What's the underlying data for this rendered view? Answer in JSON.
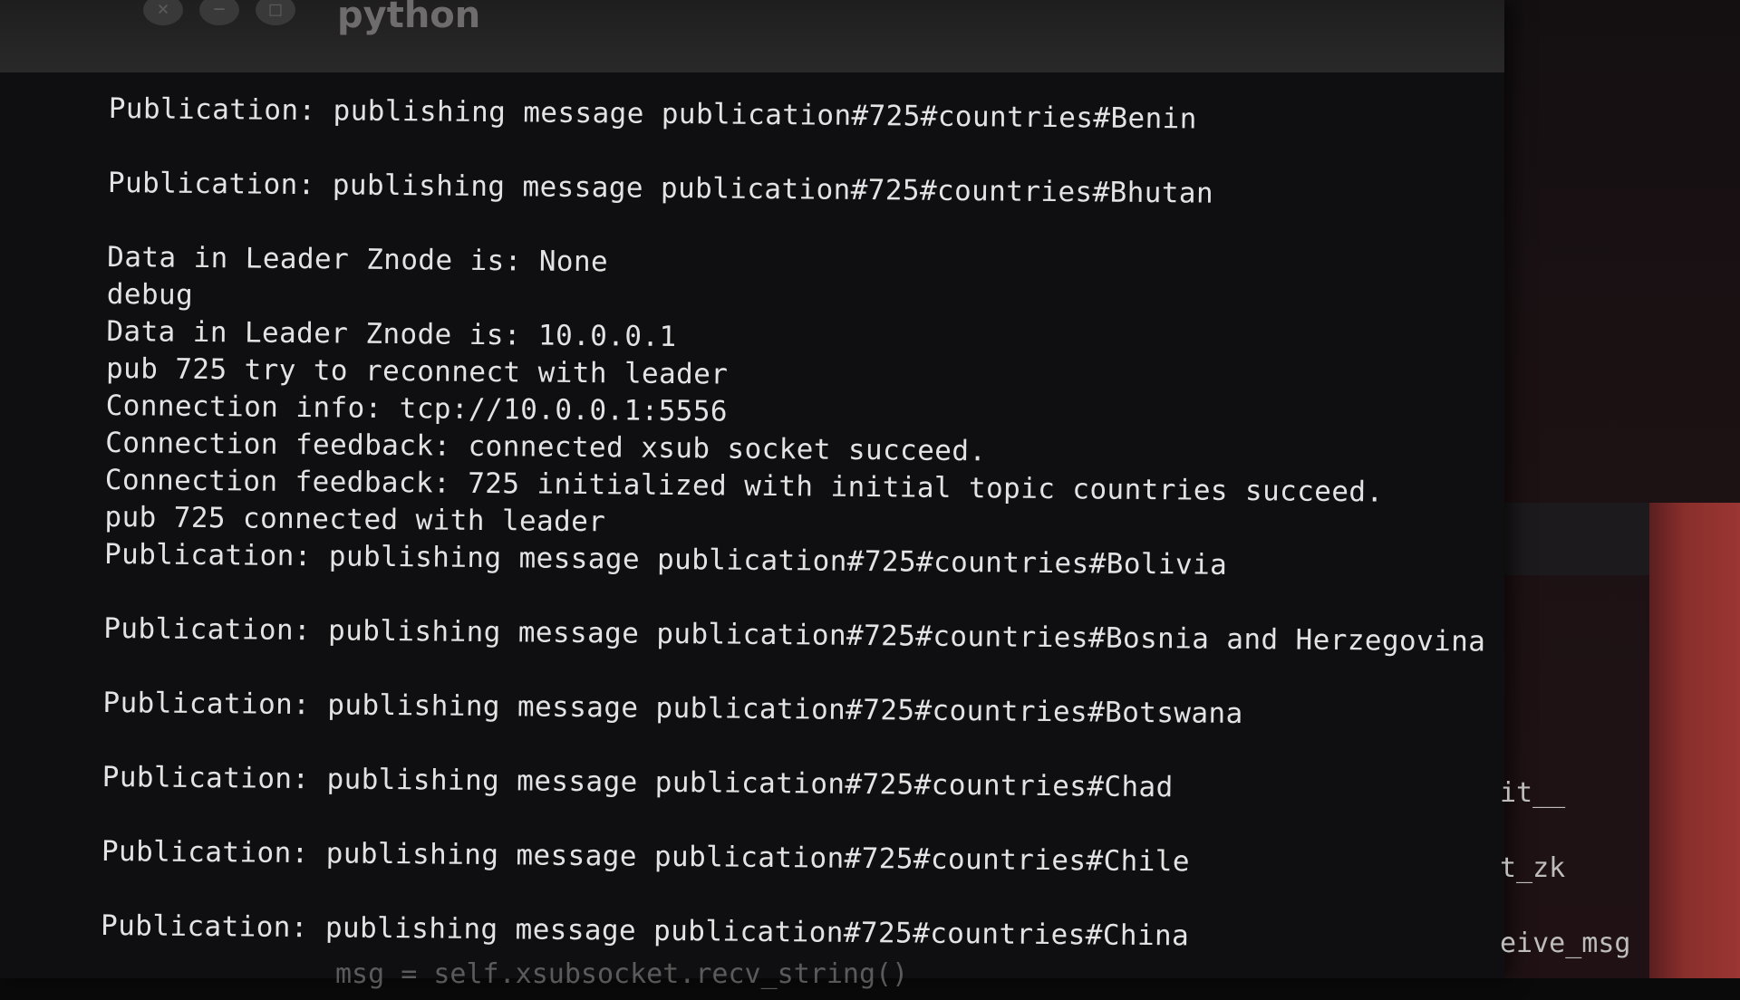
{
  "window": {
    "title": "python",
    "buttons": [
      "×",
      "−",
      "□"
    ]
  },
  "terminal": {
    "lines": [
      "Publication: publishing message publication#725#countries#Benin",
      "",
      "Publication: publishing message publication#725#countries#Bhutan",
      "",
      "Data in Leader Znode is: None",
      "debug",
      "Data in Leader Znode is: 10.0.0.1",
      "pub 725 try to reconnect with leader",
      "Connection info: tcp://10.0.0.1:5556",
      "Connection feedback: connected xsub socket succeed.",
      "Connection feedback: 725 initialized with initial topic countries succeed.",
      "pub 725 connected with leader",
      "Publication: publishing message publication#725#countries#Bolivia",
      "",
      "Publication: publishing message publication#725#countries#Bosnia and Herzegovina",
      "",
      "Publication: publishing message publication#725#countries#Botswana",
      "",
      "Publication: publishing message publication#725#countries#Chad",
      "",
      "Publication: publishing message publication#725#countries#Chile",
      "",
      "Publication: publishing message publication#725#countries#China"
    ],
    "partial_bottom": "msg = self.xsubsocket.recv_string()"
  },
  "background_window": {
    "fragments": [
      "it__",
      "t_zk",
      "eive_msg"
    ]
  }
}
